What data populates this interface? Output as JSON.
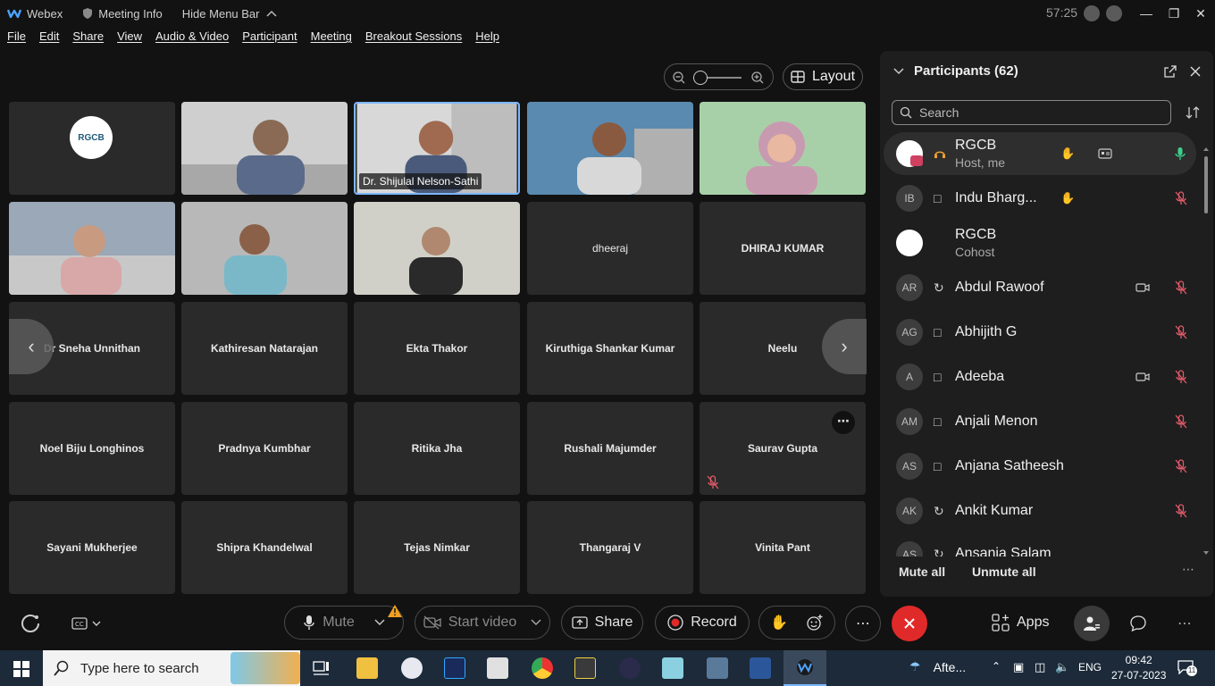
{
  "titlebar": {
    "app_name": "Webex",
    "meeting_info": "Meeting Info",
    "hide_menu_bar": "Hide Menu Bar",
    "timer": "57:25"
  },
  "menu": [
    "File",
    "Edit",
    "Share",
    "View",
    "Audio & Video",
    "Participant",
    "Meeting",
    "Breakout Sessions",
    "Help"
  ],
  "toolbar": {
    "layout_label": "Layout"
  },
  "tiles": [
    {
      "name": "RGCB-logo",
      "label": "RGCB"
    },
    {
      "name": "video-1",
      "label": ""
    },
    {
      "name": "Dr. Shijulal Nelson-Sathi",
      "label": "Dr. Shijulal Nelson-Sathi"
    },
    {
      "name": "video-3",
      "label": ""
    },
    {
      "name": "video-4",
      "label": ""
    },
    {
      "name": "video-5",
      "label": ""
    },
    {
      "name": "video-6",
      "label": ""
    },
    {
      "name": "video-7",
      "label": ""
    },
    {
      "name": "dheeraj",
      "label": "dheeraj"
    },
    {
      "name": "DHIRAJ KUMAR",
      "label": "DHIRAJ KUMAR"
    },
    {
      "name": "Dr Sneha Unnithan",
      "label": "Dr Sneha Unnithan"
    },
    {
      "name": "Kathiresan Natarajan",
      "label": "Kathiresan Natarajan"
    },
    {
      "name": "Ekta Thakor",
      "label": "Ekta Thakor"
    },
    {
      "name": "Kiruthiga Shankar Kumar",
      "label": "Kiruthiga Shankar Kumar"
    },
    {
      "name": "Neelu",
      "label": "Neelu"
    },
    {
      "name": "Noel Biju Longhinos",
      "label": "Noel Biju Longhinos"
    },
    {
      "name": "Pradnya Kumbhar",
      "label": "Pradnya Kumbhar"
    },
    {
      "name": "Ritika Jha",
      "label": "Ritika Jha"
    },
    {
      "name": "Rushali Majumder",
      "label": "Rushali Majumder"
    },
    {
      "name": "Saurav Gupta",
      "label": "Saurav Gupta"
    },
    {
      "name": "Sayani Mukherjee",
      "label": "Sayani Mukherjee"
    },
    {
      "name": "Shipra Khandelwal",
      "label": "Shipra Khandelwal"
    },
    {
      "name": "Tejas Nimkar",
      "label": "Tejas Nimkar"
    },
    {
      "name": "Thangaraj V",
      "label": "Thangaraj V"
    },
    {
      "name": "Vinita Pant",
      "label": "Vinita Pant"
    }
  ],
  "participants_panel": {
    "title": "Participants (62)",
    "search_placeholder": "Search",
    "rows": [
      {
        "initials": "",
        "name": "RGCB",
        "sub": "Host, me"
      },
      {
        "initials": "IB",
        "name": "Indu Bhargava",
        "display": "Indu Bharg..."
      },
      {
        "initials": "",
        "name": "RGCB",
        "sub": "Cohost"
      },
      {
        "initials": "AR",
        "name": "Abdul Rawoof"
      },
      {
        "initials": "AG",
        "name": "Abhijith G"
      },
      {
        "initials": "A",
        "name": "Adeeba"
      },
      {
        "initials": "AM",
        "name": "Anjali Menon"
      },
      {
        "initials": "AS",
        "name": "Anjana Satheesh"
      },
      {
        "initials": "AK",
        "name": "Ankit Kumar"
      },
      {
        "initials": "AS",
        "name": "Ansania Salam"
      }
    ],
    "mute_all": "Mute all",
    "unmute_all": "Unmute all"
  },
  "controls": {
    "mute": "Mute",
    "start_video": "Start video",
    "share": "Share",
    "record": "Record",
    "apps": "Apps"
  },
  "taskbar": {
    "search_placeholder": "Type here to search",
    "weather": "Afte...",
    "language": "ENG",
    "time": "09:42",
    "date": "27-07-2023",
    "notifications": "11"
  },
  "colors": {
    "accent_blue": "#7cb7ff",
    "leave_red": "#e02a2a",
    "mic_off_red": "#e05a6a",
    "mic_on_green": "#3bd08b"
  }
}
